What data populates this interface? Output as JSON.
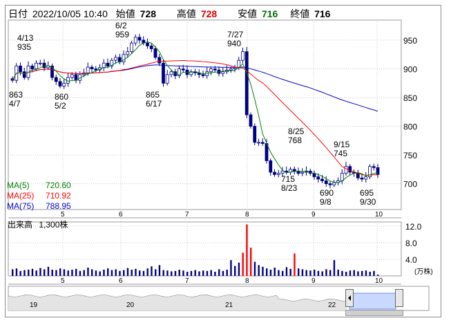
{
  "header": {
    "date_label": "日付",
    "datetime": "2022/10/05 10:40",
    "open_label": "始値",
    "open": "728",
    "high_label": "高値",
    "high": "728",
    "low_label": "安値",
    "low": "716",
    "close_label": "終値",
    "close": "716"
  },
  "colors": {
    "ma5": "#008000",
    "ma25": "#ff0000",
    "ma75": "#0000cc",
    "up": "#ffffff",
    "down": "#000080",
    "grid": "#c8c8c8",
    "volume": "#000080",
    "volume_spike": "#ff0000"
  },
  "chart_data": [
    {
      "type": "candlestick",
      "title": "",
      "x_ticks": [
        "5",
        "6",
        "7",
        "8",
        "9",
        "10"
      ],
      "y_ticks": [
        "950",
        "900",
        "850",
        "800",
        "750",
        "700"
      ],
      "ylim": [
        655,
        985
      ],
      "grid": true,
      "annotations": [
        {
          "line1": "4/13",
          "line2": "935",
          "kind": "high"
        },
        {
          "line1": "863",
          "line2": "4/7",
          "kind": "low"
        },
        {
          "line1": "860",
          "line2": "5/2",
          "kind": "low"
        },
        {
          "line1": "6/2",
          "line2": "959",
          "kind": "high"
        },
        {
          "line1": "865",
          "line2": "6/17",
          "kind": "low"
        },
        {
          "line1": "7/27",
          "line2": "940",
          "kind": "high"
        },
        {
          "line1": "8/25",
          "line2": "768",
          "kind": "high"
        },
        {
          "line1": "715",
          "line2": "8/23",
          "kind": "low"
        },
        {
          "line1": "690",
          "line2": "9/8",
          "kind": "low"
        },
        {
          "line1": "9/15",
          "line2": "745",
          "kind": "high"
        },
        {
          "line1": "695",
          "line2": "9/30",
          "kind": "low"
        }
      ],
      "closes": [
        880,
        905,
        895,
        885,
        905,
        900,
        910,
        910,
        902,
        905,
        885,
        878,
        870,
        875,
        885,
        890,
        880,
        890,
        893,
        903,
        900,
        898,
        902,
        910,
        905,
        915,
        920,
        912,
        925,
        930,
        945,
        955,
        950,
        945,
        940,
        935,
        920,
        910,
        875,
        890,
        895,
        888,
        900,
        898,
        890,
        895,
        893,
        890,
        888,
        895,
        900,
        898,
        892,
        895,
        898,
        900,
        902,
        915,
        930,
        820,
        800,
        772,
        772,
        770,
        740,
        720,
        716,
        718,
        722,
        720,
        725,
        722,
        718,
        720,
        722,
        718,
        712,
        708,
        705,
        700,
        698,
        702,
        705,
        718,
        730,
        720,
        718,
        710,
        708,
        712,
        730,
        728,
        716
      ],
      "ma_legend": [
        {
          "label": "MA(5)",
          "value": "720.60",
          "color": "#008000"
        },
        {
          "label": "MA(25)",
          "value": "710.92",
          "color": "#ff0000"
        },
        {
          "label": "MA(75)",
          "value": "788.95",
          "color": "#0000cc"
        }
      ]
    },
    {
      "type": "bar",
      "title": "出来高",
      "subtitle": "1,300株",
      "unit": "(万株)",
      "x_ticks": [
        "5",
        "6",
        "7",
        "8",
        "9",
        "10"
      ],
      "y_ticks": [
        "12.0",
        "8.0",
        "4.0"
      ],
      "ylim": [
        0,
        13
      ],
      "values": [
        1.6,
        1.8,
        1.2,
        1.4,
        1.5,
        1.7,
        1.3,
        1.9,
        1.6,
        2.2,
        1.5,
        1.4,
        1.8,
        1.6,
        1.3,
        1.5,
        1.7,
        1.2,
        1.4,
        2.0,
        1.6,
        1.3,
        1.1,
        1.5,
        1.8,
        1.4,
        1.6,
        1.2,
        1.4,
        1.9,
        1.5,
        1.7,
        1.3,
        1.2,
        1.8,
        2.3,
        1.6,
        2.6,
        1.4,
        1.3,
        1.1,
        1.2,
        1.5,
        1.3,
        1.0,
        1.2,
        1.4,
        1.1,
        1.3,
        1.2,
        1.4,
        1.0,
        1.6,
        1.2,
        1.5,
        3.8,
        2.4,
        3.2,
        5.6,
        12.4,
        6.8,
        3.4,
        2.6,
        2.2,
        1.8,
        1.5,
        2.0,
        1.4,
        1.2,
        2.1,
        1.7,
        5.4,
        1.8,
        1.6,
        1.4,
        1.3,
        1.5,
        1.2,
        1.1,
        1.6,
        1.4,
        3.8,
        1.5,
        1.2,
        1.0,
        1.3,
        1.4,
        1.1,
        1.2,
        1.3,
        1.0,
        1.2,
        0.3
      ]
    }
  ],
  "overview": {
    "x_ticks": [
      "19",
      "20",
      "21",
      "22"
    ]
  }
}
